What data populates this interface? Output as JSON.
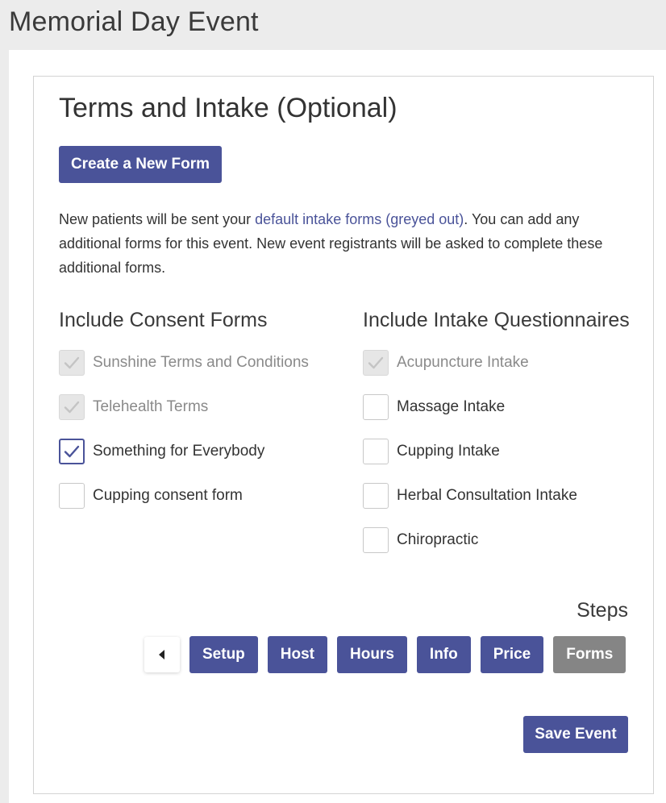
{
  "page": {
    "title": "Memorial Day Event"
  },
  "section": {
    "title": "Terms and Intake (Optional)",
    "create_button_label": "Create a New Form",
    "intro_before_link": "New patients will be sent your ",
    "intro_link": "default intake forms (greyed out)",
    "intro_after_link": ". You can add any additional forms for this event. New event registrants will be asked to complete these additional forms."
  },
  "consent": {
    "heading": "Include Consent Forms",
    "items": [
      {
        "label": "Sunshine Terms and Conditions",
        "checked": true,
        "disabled": true
      },
      {
        "label": "Telehealth Terms",
        "checked": true,
        "disabled": true
      },
      {
        "label": "Something for Everybody",
        "checked": true,
        "disabled": false
      },
      {
        "label": "Cupping consent form",
        "checked": false,
        "disabled": false
      }
    ]
  },
  "intake": {
    "heading": "Include Intake Questionnaires",
    "items": [
      {
        "label": "Acupuncture Intake",
        "checked": true,
        "disabled": true
      },
      {
        "label": "Massage Intake",
        "checked": false,
        "disabled": false
      },
      {
        "label": "Cupping Intake",
        "checked": false,
        "disabled": false
      },
      {
        "label": "Herbal Consultation Intake",
        "checked": false,
        "disabled": false
      },
      {
        "label": "Chiropractic",
        "checked": false,
        "disabled": false
      }
    ]
  },
  "steps": {
    "label": "Steps",
    "prev_icon": "caret-left-icon",
    "items": [
      {
        "label": "Setup",
        "current": false
      },
      {
        "label": "Host",
        "current": false
      },
      {
        "label": "Hours",
        "current": false
      },
      {
        "label": "Info",
        "current": false
      },
      {
        "label": "Price",
        "current": false
      },
      {
        "label": "Forms",
        "current": true
      }
    ]
  },
  "footer": {
    "save_label": "Save Event"
  },
  "colors": {
    "primary": "#4a5399",
    "current_step": "#858585",
    "background": "#ececec",
    "disabled_check": "#c4c4c4"
  }
}
